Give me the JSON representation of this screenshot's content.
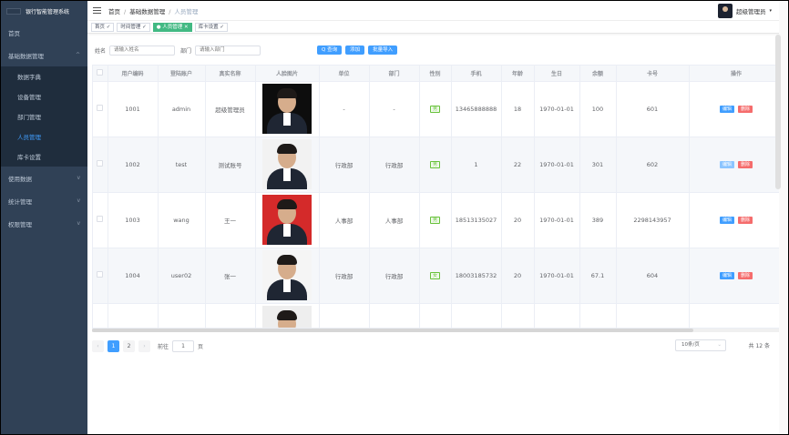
{
  "app_title": "银行智能管理系统",
  "sidebar": {
    "items": [
      {
        "label": "首页",
        "has_children": false
      },
      {
        "label": "基础数据管理",
        "has_children": true,
        "open": true,
        "chevron": "^"
      },
      {
        "label": "数据字典",
        "sub": true
      },
      {
        "label": "设备管理",
        "sub": true
      },
      {
        "label": "部门管理",
        "sub": true
      },
      {
        "label": "人员管理",
        "sub": true,
        "active": true
      },
      {
        "label": "库卡设置",
        "sub": true
      },
      {
        "label": "使用数据",
        "has_children": true,
        "chevron": "v"
      },
      {
        "label": "统计管理",
        "has_children": true,
        "chevron": "v"
      },
      {
        "label": "权限管理",
        "has_children": true,
        "chevron": "v"
      }
    ]
  },
  "navbar": {
    "breadcrumb": [
      "首页",
      "基础数据管理",
      "人员管理"
    ],
    "separator": "/",
    "user_name": "超级管理员",
    "user_caret": "▾"
  },
  "tags": [
    {
      "label": "首页 ✓"
    },
    {
      "label": "时间管理 ✓"
    },
    {
      "label": "● 人员管理 ✕",
      "active": true
    },
    {
      "label": "库卡设置 ✓"
    }
  ],
  "search": {
    "name_label": "姓名",
    "name_placeholder": "请输入姓名",
    "dept_label": "部门",
    "dept_placeholder": "请输入部门",
    "query_label": "Q 查询",
    "add_label": "添加",
    "import_label": "批量导入"
  },
  "table": {
    "headers": [
      "用户编码",
      "登陆账户",
      "真实名称",
      "人脸图片",
      "单位",
      "部门",
      "性别",
      "手机",
      "年龄",
      "生日",
      "余额",
      "卡号",
      "操作"
    ],
    "edit_label": "编辑",
    "delete_label": "删除",
    "rows": [
      {
        "code": "1001",
        "account": "admin",
        "name": "超级管理员",
        "unit": "-",
        "dept": "-",
        "sex": "男",
        "phone": "13465888888",
        "age": "18",
        "birthday": "1970-01-01",
        "balance": "100",
        "card": "601",
        "photo_bg": "#0d0d0d"
      },
      {
        "code": "1002",
        "account": "test",
        "name": "测试账号",
        "unit": "行政部",
        "dept": "行政部",
        "sex": "男",
        "phone": "1",
        "age": "22",
        "birthday": "1970-01-01",
        "balance": "301",
        "card": "602",
        "photo_bg": "#f2f2f2"
      },
      {
        "code": "1003",
        "account": "wang",
        "name": "王一",
        "unit": "人事部",
        "dept": "人事部",
        "sex": "男",
        "phone": "18513135027",
        "age": "20",
        "birthday": "1970-01-01",
        "balance": "389",
        "card": "2298143957",
        "photo_bg": "#d42a2a"
      },
      {
        "code": "1004",
        "account": "user02",
        "name": "张一",
        "unit": "行政部",
        "dept": "行政部",
        "sex": "女",
        "phone": "18003185732",
        "age": "20",
        "birthday": "1970-01-01",
        "balance": "67.1",
        "card": "604",
        "photo_bg": "#f5f5f5"
      },
      {
        "code": "",
        "account": "",
        "name": "",
        "unit": "",
        "dept": "",
        "sex": "",
        "phone": "",
        "age": "",
        "birthday": "",
        "balance": "",
        "card": "",
        "photo_bg": "#eeeeee"
      }
    ]
  },
  "pagination": {
    "prev": "‹",
    "pages": [
      "1",
      "2"
    ],
    "current": "1",
    "next": "›",
    "goto_label": "前往",
    "goto_value": "1",
    "page_unit": "页",
    "page_size": "10条/页",
    "total": "共 12 条"
  }
}
